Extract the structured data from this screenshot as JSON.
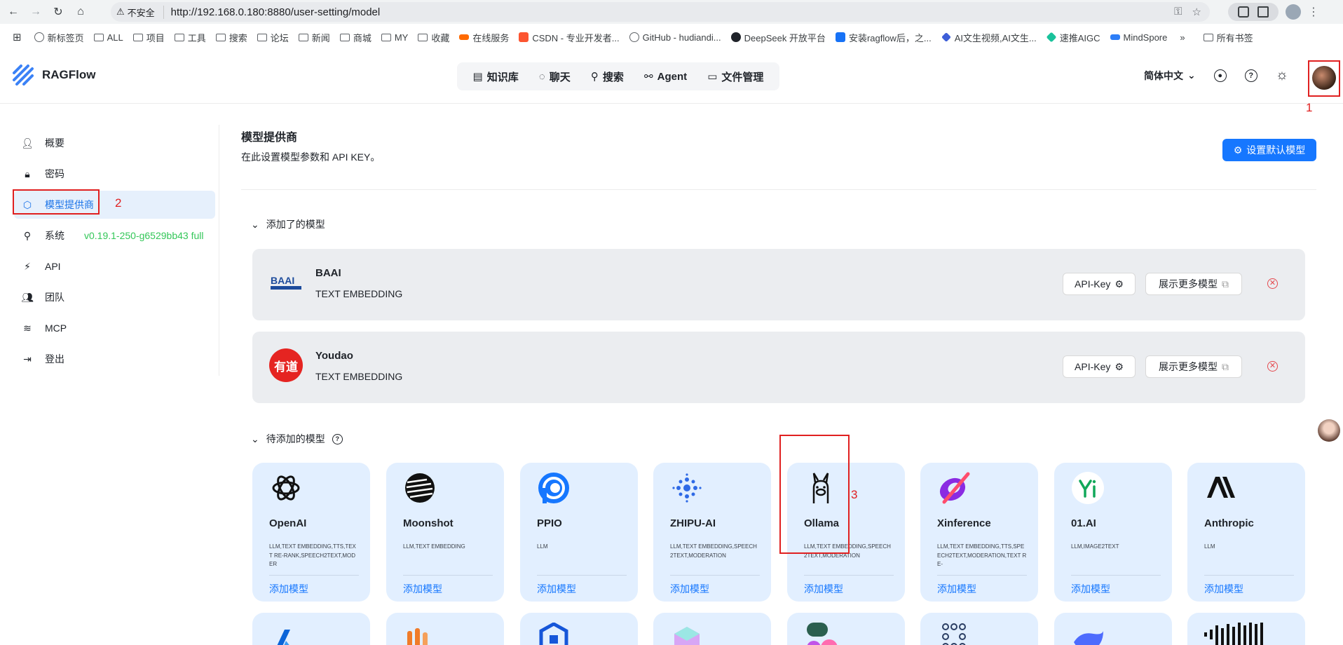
{
  "browser": {
    "security_label": "不安全",
    "url": "http://192.168.0.180:8880/user-setting/model",
    "bookmarks": [
      "新标签页",
      "ALL",
      "项目",
      "工具",
      "搜索",
      "论坛",
      "新闻",
      "商城",
      "MY",
      "收藏",
      "在线服务",
      "CSDN - 专业开发者...",
      "GitHub - hudiandi...",
      "DeepSeek 开放平台",
      "安装ragflow后，之...",
      "AI文生视频,AI文生...",
      "速推AIGC",
      "MindSpore",
      "»",
      "所有书签"
    ]
  },
  "header": {
    "app_name": "RAGFlow",
    "nav": [
      "知识库",
      "聊天",
      "搜索",
      "Agent",
      "文件管理"
    ],
    "language": "简体中文"
  },
  "sidebar": {
    "items": [
      "概要",
      "密码",
      "模型提供商",
      "系统",
      "API",
      "团队",
      "MCP",
      "登出"
    ],
    "version": "v0.19.1-250-g6529bb43 full"
  },
  "main": {
    "title": "模型提供商",
    "subtitle": "在此设置模型参数和 API KEY。",
    "default_button": "设置默认模型",
    "added_section": "添加了的模型",
    "pending_section": "待添加的模型",
    "api_key_label": "API-Key",
    "more_models_label": "展示更多模型",
    "added_models": [
      {
        "name": "BAAI",
        "tags": "TEXT EMBEDDING"
      },
      {
        "name": "Youdao",
        "tags": "TEXT EMBEDDING"
      }
    ],
    "add_label": "添加模型",
    "providers": [
      {
        "name": "OpenAI",
        "tags": "LLM,TEXT EMBEDDING,TTS,TEXT RE-RANK,SPEECH2TEXT,MODER"
      },
      {
        "name": "Moonshot",
        "tags": "LLM,TEXT EMBEDDING"
      },
      {
        "name": "PPIO",
        "tags": "LLM"
      },
      {
        "name": "ZHIPU-AI",
        "tags": "LLM,TEXT EMBEDDING,SPEECH2TEXT,MODERATION"
      },
      {
        "name": "Ollama",
        "tags": "LLM,TEXT EMBEDDING,SPEECH2TEXT,MODERATION"
      },
      {
        "name": "Xinference",
        "tags": "LLM,TEXT EMBEDDING,TTS,SPEECH2TEXT,MODERATION,TEXT RE-"
      },
      {
        "name": "01.AI",
        "tags": "LLM,IMAGE2TEXT"
      },
      {
        "name": "Anthropic",
        "tags": "LLM"
      }
    ]
  },
  "annotations": [
    "1",
    "2",
    "3"
  ],
  "colors": {
    "accent": "#1677ff",
    "annotation": "#e02020",
    "card_bg": "#e2efff",
    "version": "#34c759"
  }
}
